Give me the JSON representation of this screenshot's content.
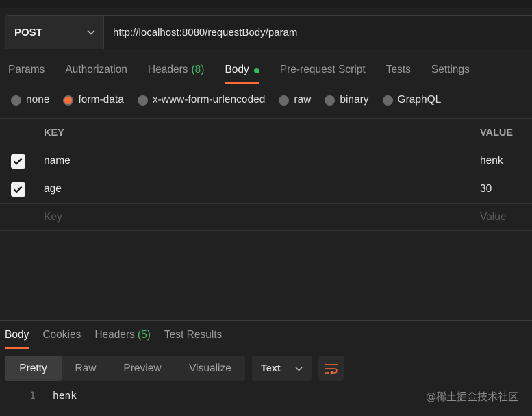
{
  "request": {
    "method": "POST",
    "url": "http://localhost:8080/requestBody/param"
  },
  "request_tabs": [
    {
      "label": "Params"
    },
    {
      "label": "Authorization"
    },
    {
      "label": "Headers",
      "count": "(8)"
    },
    {
      "label": "Body",
      "active": true
    },
    {
      "label": "Pre-request Script"
    },
    {
      "label": "Tests"
    },
    {
      "label": "Settings"
    }
  ],
  "body_types": [
    {
      "label": "none"
    },
    {
      "label": "form-data",
      "selected": true
    },
    {
      "label": "x-www-form-urlencoded"
    },
    {
      "label": "raw"
    },
    {
      "label": "binary"
    },
    {
      "label": "GraphQL"
    }
  ],
  "table": {
    "key_header": "KEY",
    "value_header": "VALUE",
    "rows": [
      {
        "key": "name",
        "value": "henk",
        "checked": true
      },
      {
        "key": "age",
        "value": "30",
        "checked": true
      }
    ],
    "placeholder_key": "Key",
    "placeholder_value": "Value"
  },
  "response_tabs": [
    {
      "label": "Body",
      "active": true
    },
    {
      "label": "Cookies"
    },
    {
      "label": "Headers",
      "count": "(5)"
    },
    {
      "label": "Test Results"
    }
  ],
  "view_modes": [
    {
      "label": "Pretty",
      "active": true
    },
    {
      "label": "Raw"
    },
    {
      "label": "Preview"
    },
    {
      "label": "Visualize"
    }
  ],
  "format_select": "Text",
  "response_body": {
    "line_number": "1",
    "content": "henk"
  },
  "watermark": "@稀土掘金技术社区",
  "colors": {
    "accent": "#ff6c37",
    "count_green": "#49b56a",
    "status_dot": "#2fbf5d",
    "background": "#212121"
  },
  "icons": {
    "method_dropdown": "chevron-down-icon",
    "format_dropdown": "chevron-down-icon",
    "wrap": "wrap-lines-icon",
    "checkbox": "checkmark-icon"
  }
}
